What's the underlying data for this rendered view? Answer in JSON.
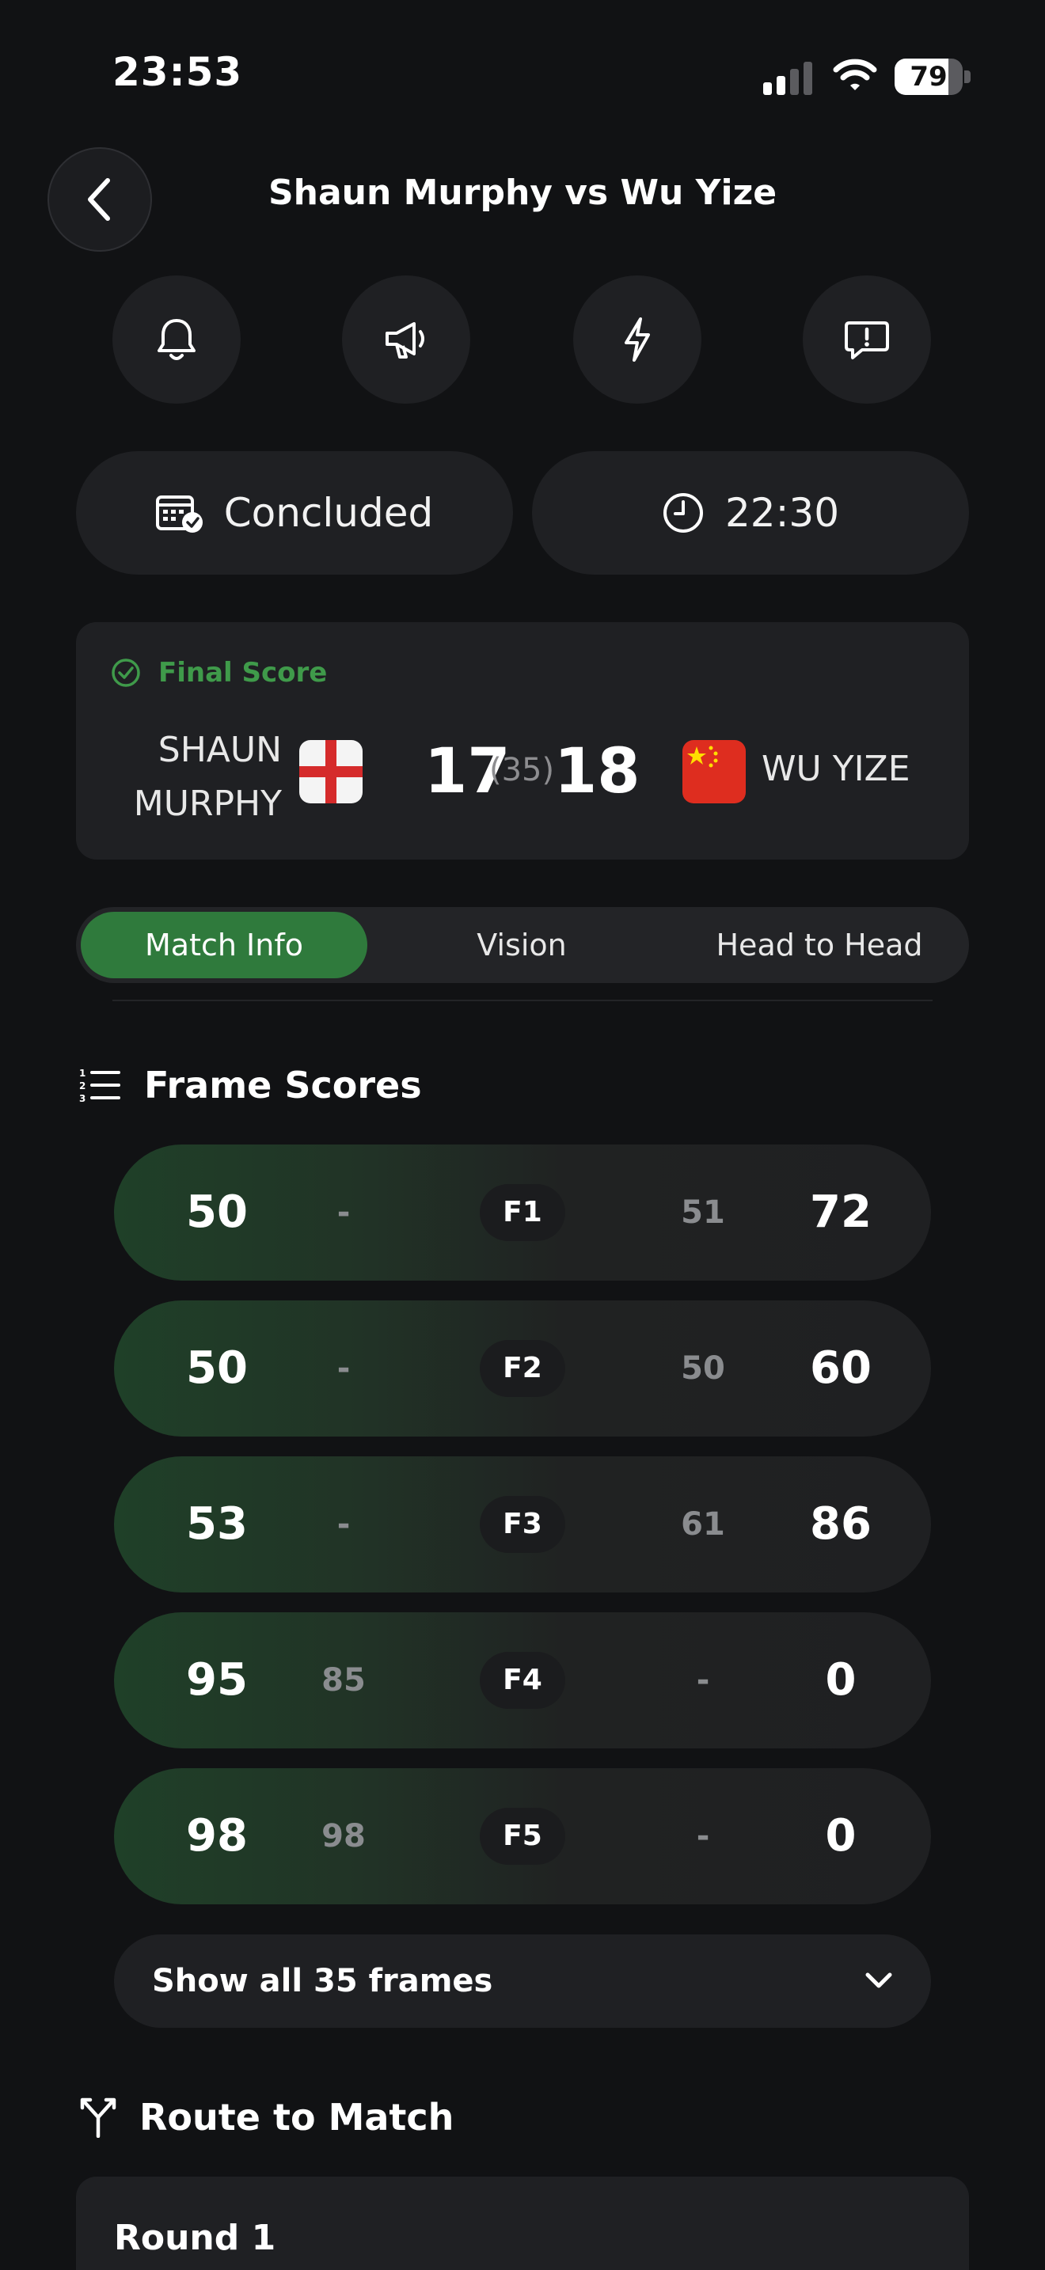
{
  "status_bar": {
    "time": "23:53",
    "battery_level": 79,
    "battery_text": "79"
  },
  "header": {
    "title": "Shaun Murphy vs Wu Yize"
  },
  "actions": [
    {
      "name": "bell-icon"
    },
    {
      "name": "megaphone-icon"
    },
    {
      "name": "lightning-icon"
    },
    {
      "name": "report-icon"
    }
  ],
  "match_status": {
    "state": "Concluded",
    "start_time": "22:30"
  },
  "final_score": {
    "label": "Final Score",
    "player_left_line1": "SHAUN",
    "player_left_line2": "MURPHY",
    "player_right": "WU YIZE",
    "score_left": "17",
    "best_of": "(35)",
    "score_right": "18",
    "accent": "#3f9a4a"
  },
  "tabs": [
    {
      "label": "Match Info",
      "active": true
    },
    {
      "label": "Vision",
      "active": false
    },
    {
      "label": "Head to Head",
      "active": false
    }
  ],
  "frame_scores": {
    "title": "Frame Scores",
    "frames": [
      {
        "left_score": "50",
        "left_break": "-",
        "label": "F1",
        "right_break": "51",
        "right_score": "72"
      },
      {
        "left_score": "50",
        "left_break": "-",
        "label": "F2",
        "right_break": "50",
        "right_score": "60"
      },
      {
        "left_score": "53",
        "left_break": "-",
        "label": "F3",
        "right_break": "61",
        "right_score": "86"
      },
      {
        "left_score": "95",
        "left_break": "85",
        "label": "F4",
        "right_break": "-",
        "right_score": "0"
      },
      {
        "left_score": "98",
        "left_break": "98",
        "label": "F5",
        "right_break": "-",
        "right_score": "0"
      }
    ],
    "show_all_label": "Show all 35 frames"
  },
  "route": {
    "title": "Route to Match",
    "round_title": "Round 1"
  }
}
